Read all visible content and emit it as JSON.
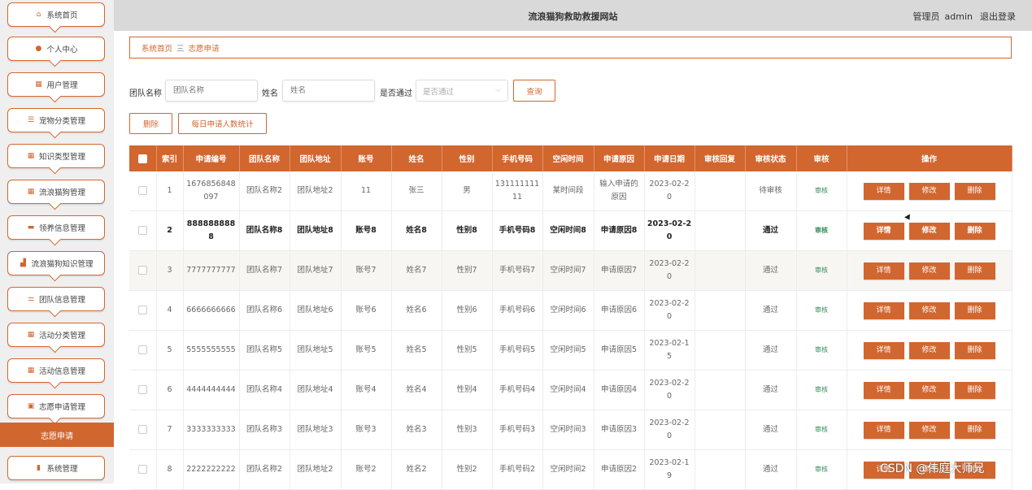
{
  "sidebar": {
    "items": [
      {
        "label": "系统首页",
        "icon": "home-icon"
      },
      {
        "label": "个人中心",
        "icon": "user-icon"
      },
      {
        "label": "用户管理",
        "icon": "grid-icon"
      },
      {
        "label": "宠物分类管理",
        "icon": "list-icon"
      },
      {
        "label": "知识类型管理",
        "icon": "grid-icon"
      },
      {
        "label": "流浪猫狗管理",
        "icon": "grid-icon"
      },
      {
        "label": "领养信息管理",
        "icon": "ticket-icon"
      },
      {
        "label": "流浪猫狗知识管理",
        "icon": "chart-icon"
      },
      {
        "label": "团队信息管理",
        "icon": "sliders-icon"
      },
      {
        "label": "活动分类管理",
        "icon": "grid-icon"
      },
      {
        "label": "活动信息管理",
        "icon": "grid-icon"
      },
      {
        "label": "志愿申请管理",
        "icon": "clipboard-icon"
      }
    ],
    "active_sub": "志愿申请",
    "last_item": {
      "label": "系统管理",
      "icon": "bar-chart-icon"
    }
  },
  "header": {
    "title": "流浪猫狗救助救援网站",
    "role": "管理员",
    "username": "admin",
    "logout": "退出登录"
  },
  "breadcrumb": {
    "home": "系统首页",
    "separator": "三",
    "current": "志愿申请"
  },
  "search": {
    "team_label": "团队名称",
    "team_placeholder": "团队名称",
    "name_label": "姓名",
    "name_placeholder": "姓名",
    "pass_label": "是否通过",
    "pass_placeholder": "是否通过",
    "query_button": "查询"
  },
  "actions": {
    "delete": "删除",
    "stats": "每日申请人数统计"
  },
  "table": {
    "headers": [
      "索引",
      "申请编号",
      "团队名称",
      "团队地址",
      "账号",
      "姓名",
      "性别",
      "手机号码",
      "空闲时间",
      "申请原因",
      "申请日期",
      "审核回复",
      "审核状态",
      "审核",
      "操作"
    ],
    "audit_label": "审核",
    "op_labels": {
      "detail": "详情",
      "edit": "修改",
      "delete": "删除"
    },
    "rows": [
      {
        "idx": "1",
        "no": "1676856848097",
        "team": "团队名称2",
        "addr": "团队地址2",
        "account": "11",
        "name": "张三",
        "gender": "男",
        "phone": "13111111111",
        "free": "某时间段",
        "reason": "输入申请的原因",
        "date": "2023-02-20",
        "reply": "",
        "status": "待审核"
      },
      {
        "idx": "2",
        "no": "8888888888",
        "team": "团队名称8",
        "addr": "团队地址8",
        "account": "账号8",
        "name": "姓名8",
        "gender": "性别8",
        "phone": "手机号码8",
        "free": "空闲时间8",
        "reason": "申请原因8",
        "date": "2023-02-20",
        "reply": "",
        "status": "通过"
      },
      {
        "idx": "3",
        "no": "7777777777",
        "team": "团队名称7",
        "addr": "团队地址7",
        "account": "账号7",
        "name": "姓名7",
        "gender": "性别7",
        "phone": "手机号码7",
        "free": "空闲时间7",
        "reason": "申请原因7",
        "date": "2023-02-20",
        "reply": "",
        "status": "通过"
      },
      {
        "idx": "4",
        "no": "6666666666",
        "team": "团队名称6",
        "addr": "团队地址6",
        "account": "账号6",
        "name": "姓名6",
        "gender": "性别6",
        "phone": "手机号码6",
        "free": "空闲时间6",
        "reason": "申请原因6",
        "date": "2023-02-20",
        "reply": "",
        "status": "通过"
      },
      {
        "idx": "5",
        "no": "5555555555",
        "team": "团队名称5",
        "addr": "团队地址5",
        "account": "账号5",
        "name": "姓名5",
        "gender": "性别5",
        "phone": "手机号码5",
        "free": "空闲时间5",
        "reason": "申请原因5",
        "date": "2023-02-15",
        "reply": "",
        "status": "通过"
      },
      {
        "idx": "6",
        "no": "4444444444",
        "team": "团队名称4",
        "addr": "团队地址4",
        "account": "账号4",
        "name": "姓名4",
        "gender": "性别4",
        "phone": "手机号码4",
        "free": "空闲时间4",
        "reason": "申请原因4",
        "date": "2023-02-20",
        "reply": "",
        "status": "通过"
      },
      {
        "idx": "7",
        "no": "3333333333",
        "team": "团队名称3",
        "addr": "团队地址3",
        "account": "账号3",
        "name": "姓名3",
        "gender": "性别3",
        "phone": "手机号码3",
        "free": "空闲时间3",
        "reason": "申请原因3",
        "date": "2023-02-20",
        "reply": "",
        "status": "通过"
      },
      {
        "idx": "8",
        "no": "2222222222",
        "team": "团队名称2",
        "addr": "团队地址2",
        "account": "账号2",
        "name": "姓名2",
        "gender": "性别2",
        "phone": "手机号码2",
        "free": "空闲时间2",
        "reason": "申请原因2",
        "date": "2023-02-19",
        "reply": "",
        "status": "通过"
      }
    ]
  },
  "watermark": "CSDN @伟庭大师兄",
  "colors": {
    "accent": "#d2662f",
    "header_bg": "#d9d9d9",
    "sidebar_bg": "#efefef",
    "audit_text": "#2e8b57"
  }
}
